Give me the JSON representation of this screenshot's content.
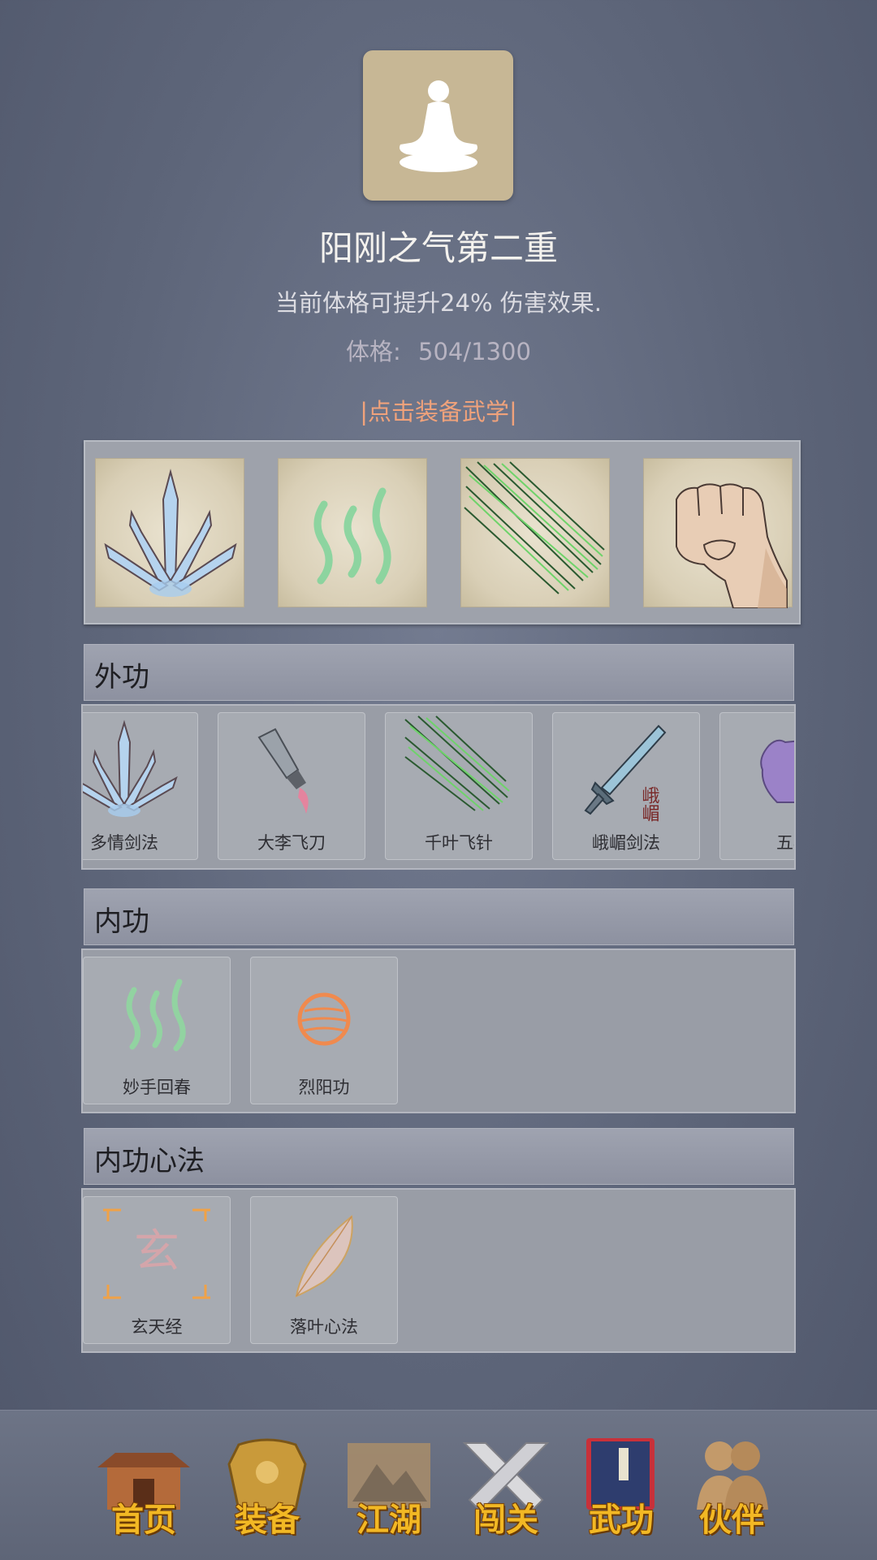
{
  "header": {
    "title": "阳刚之气第二重",
    "description": "当前体格可提升24% 伤害效果.",
    "stat_label": "体格:",
    "stat_value": "504/1300",
    "equip_link": "|点击装备武学|"
  },
  "sections": {
    "external": {
      "title": "外功",
      "items": [
        "多情剑法",
        "大李飞刀",
        "千叶飞针",
        "峨嵋剑法",
        "五毒"
      ],
      "emei_icon_text": "峨嵋"
    },
    "internal": {
      "title": "内功",
      "items": [
        "妙手回春",
        "烈阳功"
      ]
    },
    "mind": {
      "title": "内功心法",
      "items": [
        "玄天经",
        "落叶心法"
      ],
      "xuan_icon_text": "玄"
    }
  },
  "nav": {
    "items": [
      "首页",
      "装备",
      "江湖",
      "闯关",
      "武功",
      "伙伴"
    ],
    "active": "武功"
  },
  "colors": {
    "background": "#5d6579",
    "link": "#f0a27b",
    "nav_label": "#f2b824",
    "portrait": "#c7b795"
  }
}
